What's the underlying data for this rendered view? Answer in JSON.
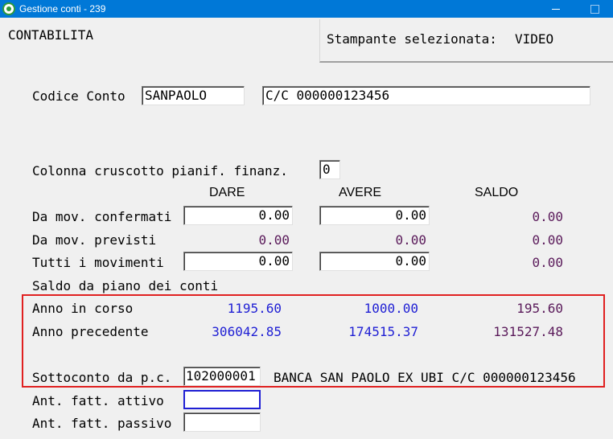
{
  "window": {
    "title": "Gestione conti - 239"
  },
  "header": {
    "module": "CONTABILITA",
    "printer_label": "Stampante selezionata:",
    "printer_value": "VIDEO"
  },
  "account": {
    "label": "Codice Conto",
    "code": "SANPAOLO",
    "description": "C/C 000000123456"
  },
  "dashboard": {
    "label": "Colonna cruscotto pianif. finanz.",
    "value": "0"
  },
  "columns": {
    "dare": "DARE",
    "avere": "AVERE",
    "saldo": "SALDO"
  },
  "movements": [
    {
      "label": "Da mov. confermati",
      "dare": "0.00",
      "avere": "0.00",
      "saldo": "0.00"
    },
    {
      "label": "Da mov. previsti",
      "dare": "0.00",
      "avere": "0.00",
      "saldo": "0.00"
    },
    {
      "label": "Tutti i movimenti",
      "dare": "0.00",
      "avere": "0.00",
      "saldo": "0.00"
    }
  ],
  "chart_of_accounts": {
    "heading": "Saldo da piano dei conti",
    "current_year": {
      "label": "Anno in corso",
      "dare": "1195.60",
      "avere": "1000.00",
      "saldo": "195.60"
    },
    "previous_year": {
      "label": "Anno precedente",
      "dare": "306042.85",
      "avere": "174515.37",
      "saldo": "131527.48"
    },
    "subaccount": {
      "label": "Sottoconto da p.c.",
      "code": "102000001",
      "description": "BANCA SAN PAOLO EX UBI C/C 000000123456"
    }
  },
  "advances": {
    "active": {
      "label": "Ant. fatt. attivo",
      "value": ""
    },
    "passive": {
      "label": "Ant. fatt. passivo",
      "value": ""
    }
  },
  "colors": {
    "titlebar": "#0078d7",
    "value_blue": "#1f1fd4",
    "value_purple": "#5a1a5a",
    "highlight": "#e02020"
  }
}
